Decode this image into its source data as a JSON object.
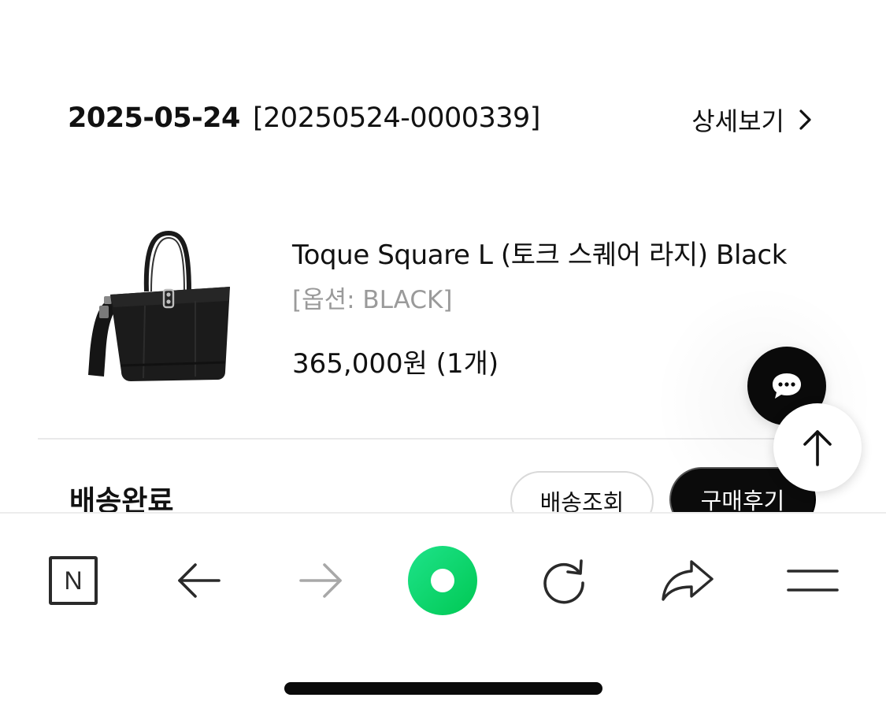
{
  "order": {
    "date": "2025-05-24",
    "number": "[20250524-0000339]",
    "detail_label": "상세보기"
  },
  "product": {
    "name": "Toque Square L (토크 스퀘어 라지) Black",
    "option": "[옵션: BLACK]",
    "price": "365,000원 (1개)",
    "image_icon": "tote-bag-image"
  },
  "delivery": {
    "status": "배송완료",
    "track_label": "배송조회",
    "review_label": "구매후기"
  },
  "floating": {
    "chat_icon": "chat-bubble-icon",
    "top_icon": "arrow-up-icon"
  },
  "toolbar": {
    "home_letter": "N",
    "items": [
      "naver-home-icon",
      "back-arrow-icon",
      "forward-arrow-icon",
      "green-dot-icon",
      "reload-icon",
      "share-icon",
      "menu-icon"
    ]
  },
  "colors": {
    "accent_green": "#03d66b",
    "option_gray": "#9a9a9a",
    "button_dark": "#0b0b0b"
  }
}
